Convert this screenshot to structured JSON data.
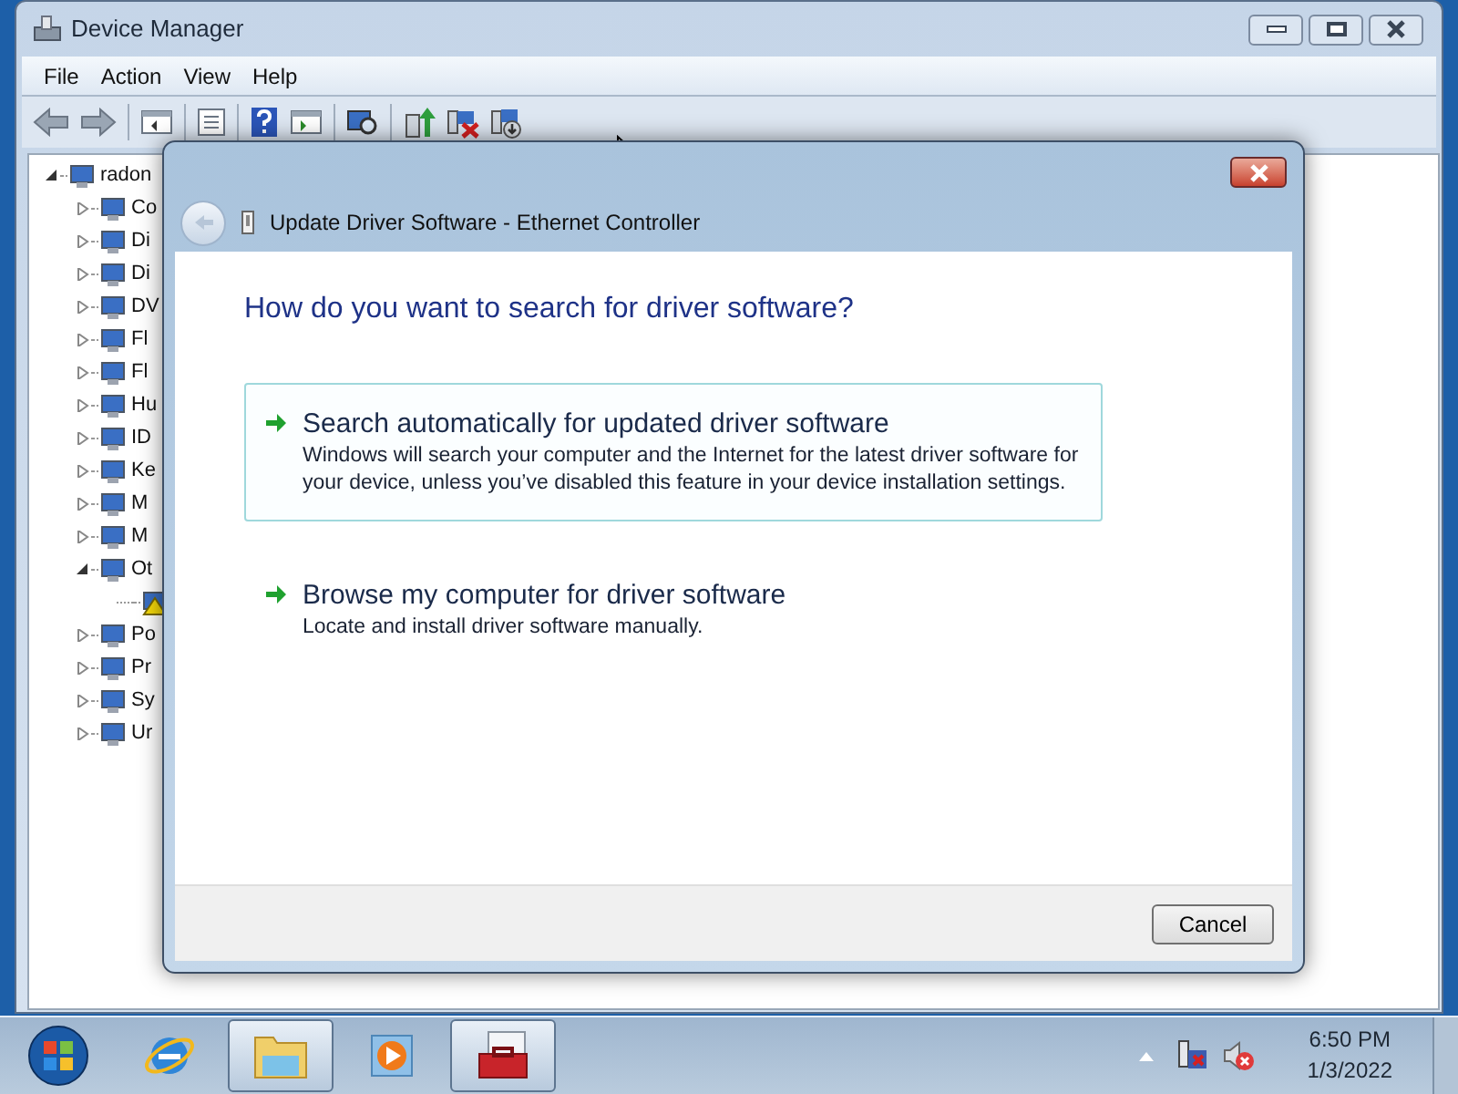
{
  "window": {
    "title": "Device Manager",
    "menu": [
      "File",
      "Action",
      "View",
      "Help"
    ]
  },
  "tree": {
    "label": "radon",
    "expanded": true,
    "children": [
      {
        "label": "Co",
        "expanded": false
      },
      {
        "label": "Di",
        "expanded": false
      },
      {
        "label": "Di",
        "expanded": false
      },
      {
        "label": "DV",
        "expanded": false
      },
      {
        "label": "Fl",
        "expanded": false
      },
      {
        "label": "Fl",
        "expanded": false
      },
      {
        "label": "Hu",
        "expanded": false
      },
      {
        "label": "ID",
        "expanded": false
      },
      {
        "label": "Ke",
        "expanded": false
      },
      {
        "label": "M",
        "expanded": false
      },
      {
        "label": "M",
        "expanded": false
      },
      {
        "label": "Ot",
        "expanded": true,
        "children": [
          {
            "warning": true
          }
        ]
      },
      {
        "label": "Po",
        "expanded": false
      },
      {
        "label": "Pr",
        "expanded": false
      },
      {
        "label": "Sy",
        "expanded": false
      },
      {
        "label": "Ur",
        "expanded": false
      }
    ]
  },
  "dialog": {
    "title": "Update Driver Software - Ethernet Controller",
    "heading": "How do you want to search for driver software?",
    "options": [
      {
        "title": "Search automatically for updated driver software",
        "description": "Windows will search your computer and the Internet for the latest driver software for your device, unless you’ve disabled this feature in your device installation settings.",
        "selected": true
      },
      {
        "title": "Browse my computer for driver software",
        "description": "Locate and install driver software manually.",
        "selected": false
      }
    ],
    "cancel": "Cancel"
  },
  "taskbar": {
    "buttons": [
      {
        "kind": "start",
        "running": false
      },
      {
        "kind": "browser",
        "running": false
      },
      {
        "kind": "folder",
        "running": true
      },
      {
        "kind": "media",
        "running": false
      },
      {
        "kind": "toolbox",
        "running": true
      }
    ],
    "clock": {
      "time": "6:50 PM",
      "date": "1/3/2022"
    }
  }
}
